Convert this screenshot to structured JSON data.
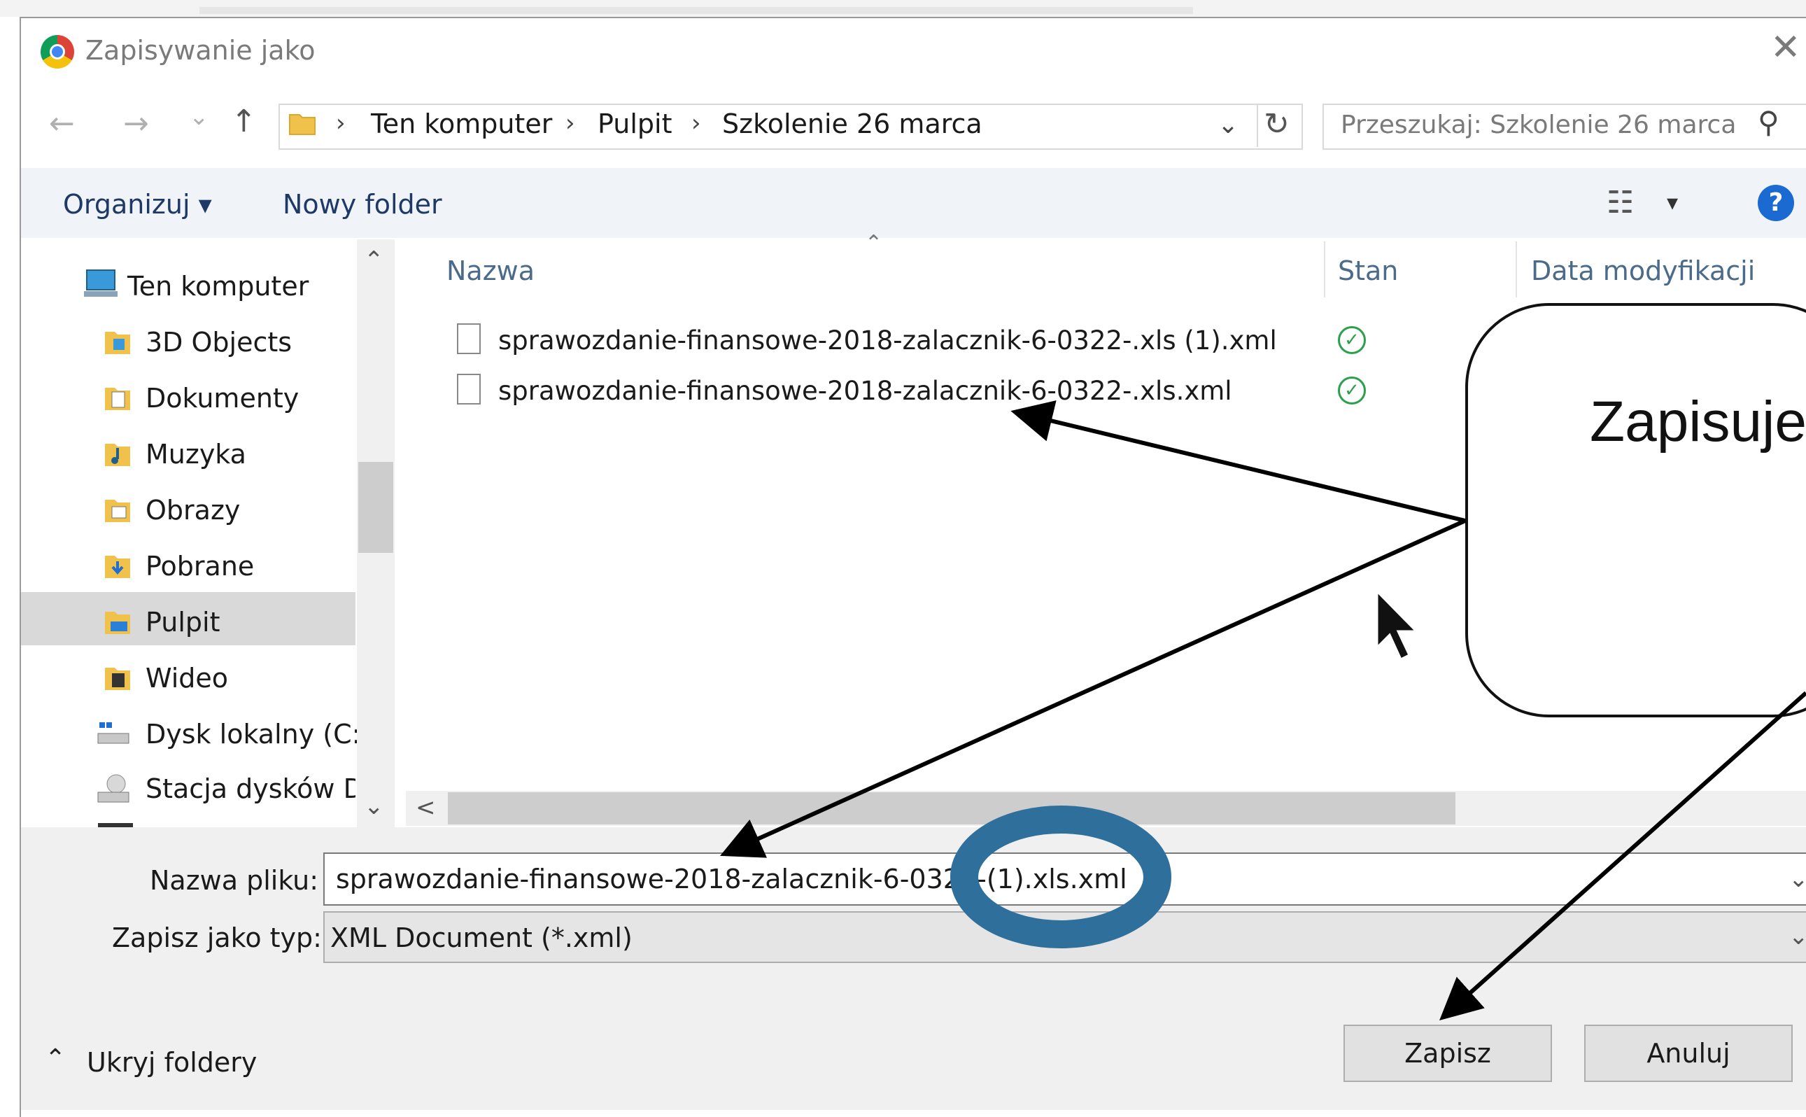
{
  "window": {
    "title": "Zapisywanie jako",
    "close_glyph": "✕"
  },
  "nav_buttons": {
    "back": "←",
    "forward": "→",
    "recent": "⌄",
    "up": "↑"
  },
  "address": {
    "segments": [
      "Ten komputer",
      "Pulpit",
      "Szkolenie 26 marca"
    ],
    "separator": "›",
    "dropdown_glyph": "⌄",
    "refresh_glyph": "↻"
  },
  "search": {
    "placeholder": "Przeszukaj: Szkolenie 26 marca",
    "icon_glyph": "⚲"
  },
  "toolbar": {
    "organize": "Organizuj ▾",
    "new_folder": "Nowy folder",
    "view_glyph": "☷",
    "view_dropdown": "▾",
    "help": "?"
  },
  "nav_pane": {
    "items": [
      {
        "label": "Ten komputer",
        "icon": "computer-icon"
      },
      {
        "label": "3D Objects",
        "icon": "folder-3d-icon"
      },
      {
        "label": "Dokumenty",
        "icon": "documents-icon"
      },
      {
        "label": "Muzyka",
        "icon": "music-icon"
      },
      {
        "label": "Obrazy",
        "icon": "pictures-icon"
      },
      {
        "label": "Pobrane",
        "icon": "downloads-icon"
      },
      {
        "label": "Pulpit",
        "icon": "desktop-icon",
        "selected": true
      },
      {
        "label": "Wideo",
        "icon": "video-icon"
      },
      {
        "label": "Dysk lokalny (C:)",
        "icon": "drive-icon"
      },
      {
        "label": "Stacja dysków D",
        "icon": "dvd-drive-icon"
      }
    ],
    "scroll_up": "⌃",
    "scroll_down": "⌄"
  },
  "columns": {
    "name": "Nazwa",
    "status": "Stan",
    "modified": "Data modyfikacji",
    "sort_glyph": "⌃"
  },
  "files": [
    {
      "name": "sprawozdanie-finansowe-2018-zalacznik-6-0322-.xls (1).xml",
      "status": "✓"
    },
    {
      "name": "sprawozdanie-finansowe-2018-zalacznik-6-0322-.xls.xml",
      "status": "✓"
    }
  ],
  "hscroll": {
    "left_glyph": "<"
  },
  "form": {
    "filename_label": "Nazwa pliku:",
    "filename_value": "sprawozdanie-finansowe-2018-zalacznik-6-0322-(1).xls.xml",
    "filetype_label": "Zapisz jako typ:",
    "filetype_value": "XML Document (*.xml)",
    "dropdown_glyph": "⌄"
  },
  "footer": {
    "hide_folders": "Ukryj foldery",
    "hide_glyph": "⌃",
    "save": "Zapisz",
    "cancel": "Anuluj"
  },
  "annotation": {
    "callout_text": "Zapisujemy",
    "highlight_color": "#2f6f9c"
  }
}
